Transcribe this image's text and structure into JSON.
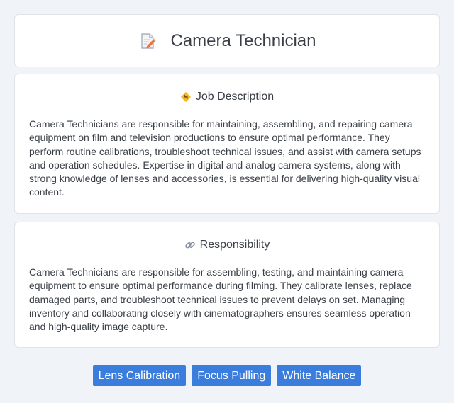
{
  "header": {
    "title": "Camera Technician",
    "icon": "document-pencil-icon"
  },
  "job_description": {
    "heading": "Job Description",
    "icon": "diamond-badge-icon",
    "body": "Camera Technicians are responsible for maintaining, assembling, and repairing camera equipment on film and television productions to ensure optimal performance. They perform routine calibrations, troubleshoot technical issues, and assist with camera setups and operation schedules. Expertise in digital and analog camera systems, along with strong knowledge of lenses and accessories, is essential for delivering high-quality visual content."
  },
  "responsibility": {
    "heading": "Responsibility",
    "icon": "link-icon",
    "body": "Camera Technicians are responsible for assembling, testing, and maintaining camera equipment to ensure optimal performance during filming. They calibrate lenses, replace damaged parts, and troubleshoot technical issues to prevent delays on set. Managing inventory and collaborating closely with cinematographers ensures seamless operation and high-quality image capture."
  },
  "tags": [
    "Lens Calibration",
    "Focus Pulling",
    "White Balance"
  ],
  "colors": {
    "background": "#f0f3f8",
    "card": "#ffffff",
    "tag": "#3b7ddd",
    "text": "#3a3f47"
  }
}
